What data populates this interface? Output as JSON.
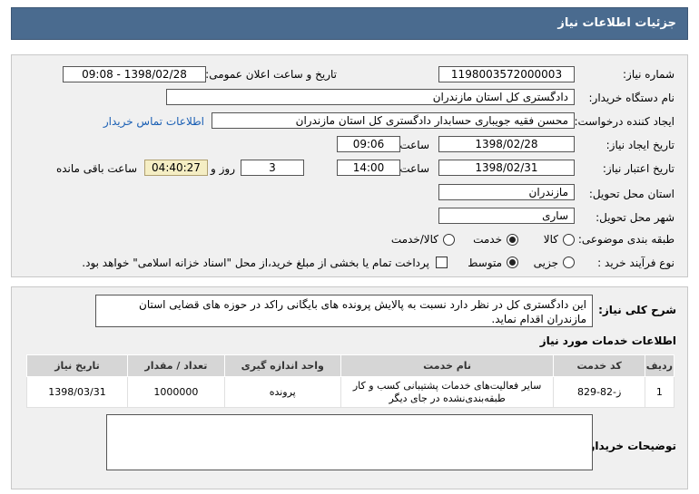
{
  "header": {
    "title": "جزئیات اطلاعات نیاز"
  },
  "form": {
    "need_number_label": "شماره نیاز:",
    "need_number": "1198003572000003",
    "announce_label": "تاریخ و ساعت اعلان عمومی:",
    "announce_value": "1398/02/28 - 09:08",
    "buyer_org_label": "نام دستگاه خریدار:",
    "buyer_org": "دادگستری کل استان مازندران",
    "requester_label": "ایجاد کننده درخواست:",
    "requester": "محسن فقیه جویباری حسابدار دادگستری کل استان مازندران",
    "contact_link": "اطلاعات تماس خریدار",
    "created_date_label": "تاریخ ایجاد نیاز:",
    "created_date": "1398/02/28",
    "time_label": "ساعت",
    "created_time": "09:06",
    "validity_label": "تاریخ اعتبار نیاز:",
    "validity_date": "1398/02/31",
    "validity_time": "14:00",
    "days": "3",
    "days_label": "روز و",
    "remaining": "04:40:27",
    "remaining_label": "ساعت باقی مانده",
    "province_label": "استان محل تحویل:",
    "province": "مازندران",
    "city_label": "شهر محل تحویل:",
    "city": "ساری",
    "category_label": "طبقه بندی موضوعی:",
    "category_options": [
      "کالا",
      "خدمت",
      "کالا/خدمت"
    ],
    "process_label": "نوع فرآیند خرید :",
    "process_options": [
      "جزیی",
      "متوسط"
    ],
    "payment_note": "پرداخت تمام یا بخشی از مبلغ خرید،از محل \"اسناد خزانه اسلامی\" خواهد بود."
  },
  "details": {
    "summary_label": "شرح کلی نیاز:",
    "summary": "این دادگستری کل در نظر دارد نسبت به پالایش پرونده های بایگانی راکد در حوزه های قضایی استان مازندران اقدام نماید.",
    "services_title": "اطلاعات خدمات مورد نیاز",
    "columns": [
      "ردیف",
      "کد خدمت",
      "نام خدمت",
      "واحد اندازه گیری",
      "تعداد / مقدار",
      "تاریخ نیاز"
    ],
    "rows": [
      {
        "row": "1",
        "code": "ز-82-829",
        "name": "سایر فعالیت‌های خدمات پشتیبانی کسب و کار طبقه‌بندی‌نشده در جای دیگر",
        "unit": "پرونده",
        "qty": "1000000",
        "date": "1398/03/31"
      }
    ],
    "buyer_notes_label": "توضیحات خریدار:"
  }
}
